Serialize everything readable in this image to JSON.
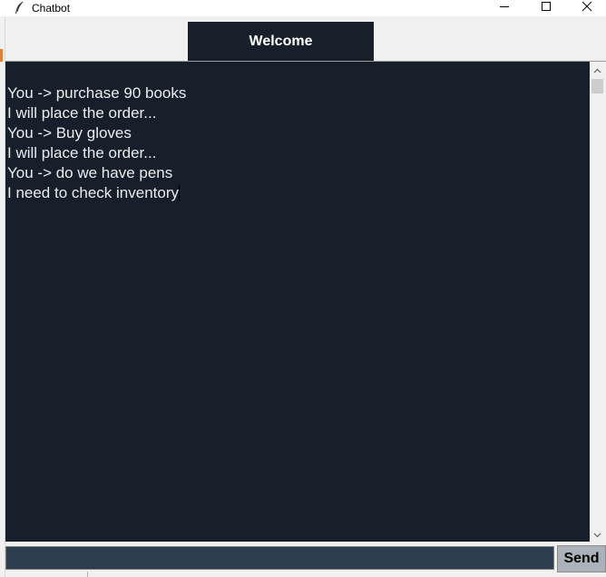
{
  "window": {
    "title": "Chatbot",
    "app_icon": "feather-icon",
    "minimize_icon": "minimize-icon",
    "maximize_icon": "maximize-icon",
    "close_icon": "close-icon"
  },
  "header": {
    "welcome_label": "Welcome"
  },
  "chat": {
    "messages": [
      "You -> purchase 90 books",
      "I will place the order...",
      "You -> Buy gloves",
      "I will place the order...",
      "You -> do we have pens",
      "I need to check inventory"
    ]
  },
  "input": {
    "value": "",
    "placeholder": ""
  },
  "send": {
    "label": "Send"
  },
  "colors": {
    "chat_bg": "#17202a",
    "chat_text": "#eaecee",
    "input_bg": "#2c3e50",
    "send_bg": "#abb2b9"
  }
}
